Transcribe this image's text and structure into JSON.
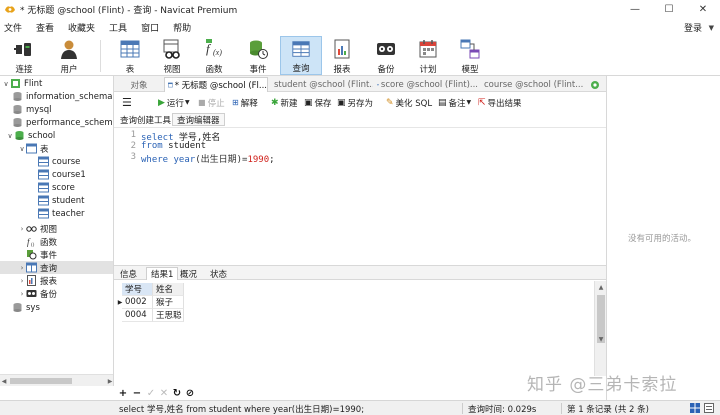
{
  "window": {
    "title": "* 无标题 @school (Flint) - 查询 - Navicat Premium",
    "minimize": "—",
    "maximize": "☐",
    "close": "✕"
  },
  "menu": {
    "items": [
      "文件",
      "查看",
      "收藏夹",
      "工具",
      "窗口",
      "帮助"
    ],
    "login": "登录"
  },
  "toolbar": {
    "items": [
      {
        "label": "连接",
        "icon": "connect-icon"
      },
      {
        "label": "用户",
        "icon": "user-icon"
      },
      {
        "label": "表",
        "icon": "table-icon"
      },
      {
        "label": "视图",
        "icon": "view-icon"
      },
      {
        "label": "函数",
        "icon": "function-icon"
      },
      {
        "label": "事件",
        "icon": "event-icon"
      },
      {
        "label": "查询",
        "icon": "query-icon",
        "active": true
      },
      {
        "label": "报表",
        "icon": "report-icon"
      },
      {
        "label": "备份",
        "icon": "backup-icon"
      },
      {
        "label": "计划",
        "icon": "schedule-icon"
      },
      {
        "label": "模型",
        "icon": "model-icon"
      }
    ]
  },
  "nav": {
    "connection": "Flint",
    "databases": {
      "information_schema": "information_schema",
      "mysql": "mysql",
      "performance_schema": "performance_schema",
      "school": "school",
      "sys": "sys"
    },
    "tables_label": "表",
    "tables": [
      "course",
      "course1",
      "score",
      "student",
      "teacher"
    ],
    "views_label": "视图",
    "functions_label": "函数",
    "events_label": "事件",
    "queries_label": "查询",
    "reports_label": "报表",
    "backups_label": "备份"
  },
  "tabs": {
    "object": "对象",
    "items": [
      "* 无标题 @school (Fl...",
      "student @school (Flint...",
      "score @school (Flint)...",
      "course @school (Flint..."
    ]
  },
  "query_toolbar": {
    "run": "运行",
    "stop": "停止",
    "explain": "解释",
    "new": "新建",
    "save": "保存",
    "save_as": "另存为",
    "beautify": "美化 SQL",
    "comment": "备注",
    "export": "导出结果"
  },
  "subtabs": {
    "builder": "查询创建工具",
    "editor": "查询编辑器"
  },
  "editor": {
    "line_numbers": [
      "1",
      "2",
      "3"
    ],
    "line1_kw": "select",
    "line1_rest": " 学号,姓名",
    "line2_kw": "from",
    "line2_rest": " student",
    "line3_kw": "where",
    "line3_fn": " year",
    "line3_paren": "(出生日期)=",
    "line3_num": "1990",
    "line3_end": ";"
  },
  "result_tabs": [
    "信息",
    "结果1",
    "概况",
    "状态"
  ],
  "grid": {
    "columns": [
      "学号",
      "姓名"
    ],
    "rows": [
      [
        "0002",
        "猴子"
      ],
      [
        "0004",
        "王思聪"
      ]
    ]
  },
  "grid_footer": {
    "add": "+",
    "delete": "−",
    "apply": "✓",
    "discard": "✕",
    "refresh": "↻",
    "stop": "⊘"
  },
  "info_panel": {
    "empty_text": "没有可用的活动。",
    "watermark": "知乎 @三弟卡索拉"
  },
  "statusbar": {
    "sql": "select 学号,姓名 from student  where year(出生日期)=1990;",
    "query_time": "查询时间: 0.029s",
    "records": "第 1 条记录 (共 2 条)"
  },
  "colors": {
    "accent": "#2a62b5",
    "number": "#d0211b",
    "active_tool": "#cde4f7"
  }
}
